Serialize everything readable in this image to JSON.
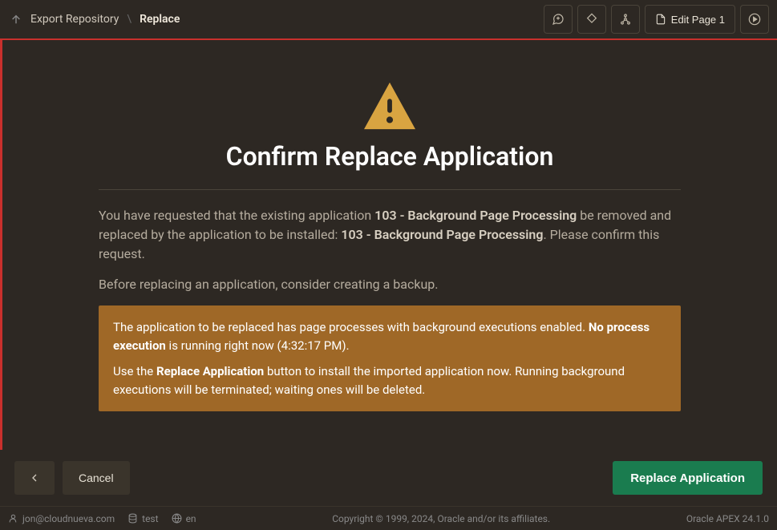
{
  "breadcrumb": {
    "parent": "Export Repository",
    "current": "Replace"
  },
  "header": {
    "edit_page_label": "Edit Page 1"
  },
  "main": {
    "title": "Confirm Replace Application",
    "p1_pre": "You have requested that the existing application ",
    "p1_app_old": "103 - Background Page Processing",
    "p1_mid": " be removed and replaced by the application to be installed: ",
    "p1_app_new": "103 - Background Page Processing",
    "p1_post": ". Please confirm this request.",
    "p2": "Before replacing an application, consider creating a backup.",
    "notice": {
      "p1_pre": "The application to be replaced has page processes with background executions enabled. ",
      "p1_strong": "No process execution",
      "p1_post": " is running right now (4:32:17 PM).",
      "p2_pre": "Use the ",
      "p2_strong": "Replace Application",
      "p2_post": " button to install the imported application now. Running background executions will be terminated; waiting ones will be deleted."
    }
  },
  "buttons": {
    "cancel": "Cancel",
    "replace": "Replace Application"
  },
  "status": {
    "user": "jon@cloudnueva.com",
    "workspace": "test",
    "language": "en",
    "copyright": "Copyright © 1999, 2024, Oracle and/or its affiliates.",
    "version": "Oracle APEX 24.1.0"
  }
}
